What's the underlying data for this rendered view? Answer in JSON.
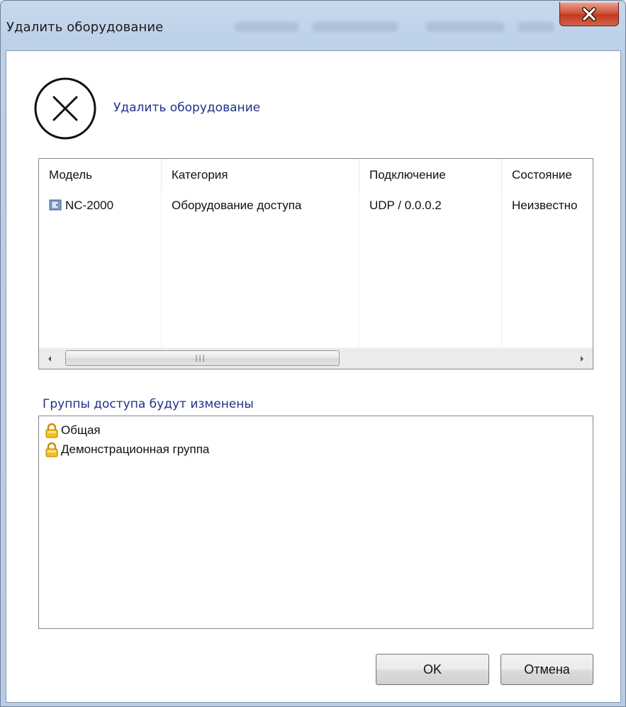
{
  "window": {
    "title": "Удалить оборудование"
  },
  "header": {
    "text": "Удалить оборудование",
    "icon": "circle-x-icon"
  },
  "equipment_list": {
    "columns": [
      "Модель",
      "Категория",
      "Подключение",
      "Состояние"
    ],
    "rows": [
      {
        "model": "NC-2000",
        "category": "Оборудование доступа",
        "connection": "UDP / 0.0.0.2",
        "status": "Неизвестно",
        "icon": "device-icon"
      }
    ],
    "scrollbar": {
      "grip": "|||"
    }
  },
  "groups": {
    "label": "Группы доступа будут изменены",
    "items": [
      {
        "label": "Общая",
        "icon": "lock-icon"
      },
      {
        "label": "Демонстрационная группа",
        "icon": "lock-icon"
      }
    ]
  },
  "buttons": {
    "ok": "OK",
    "cancel": "Отмена"
  },
  "colors": {
    "accent_text": "#1e3287",
    "close_button": "#c84a30",
    "frame": "#bcd0e8"
  }
}
